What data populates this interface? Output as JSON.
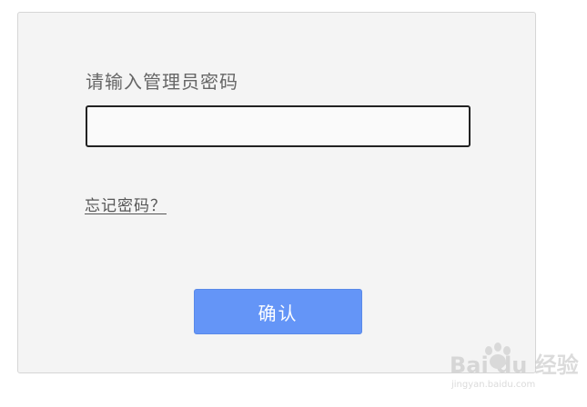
{
  "login": {
    "prompt_label": "请输入管理员密码",
    "password_value": "",
    "forgot_password_link": "忘记密码？",
    "confirm_button_label": "确认"
  },
  "watermark": {
    "logo_text": "Bai du 经验",
    "sub_text": "jingyan.baidu.com",
    "logo_icon": "baidu-paw-icon"
  },
  "colors": {
    "panel_background": "#f4f4f4",
    "panel_border": "#d6d6d6",
    "input_border": "#222222",
    "button_background": "#6495f7",
    "button_text": "#ffffff",
    "label_text": "#666666"
  }
}
